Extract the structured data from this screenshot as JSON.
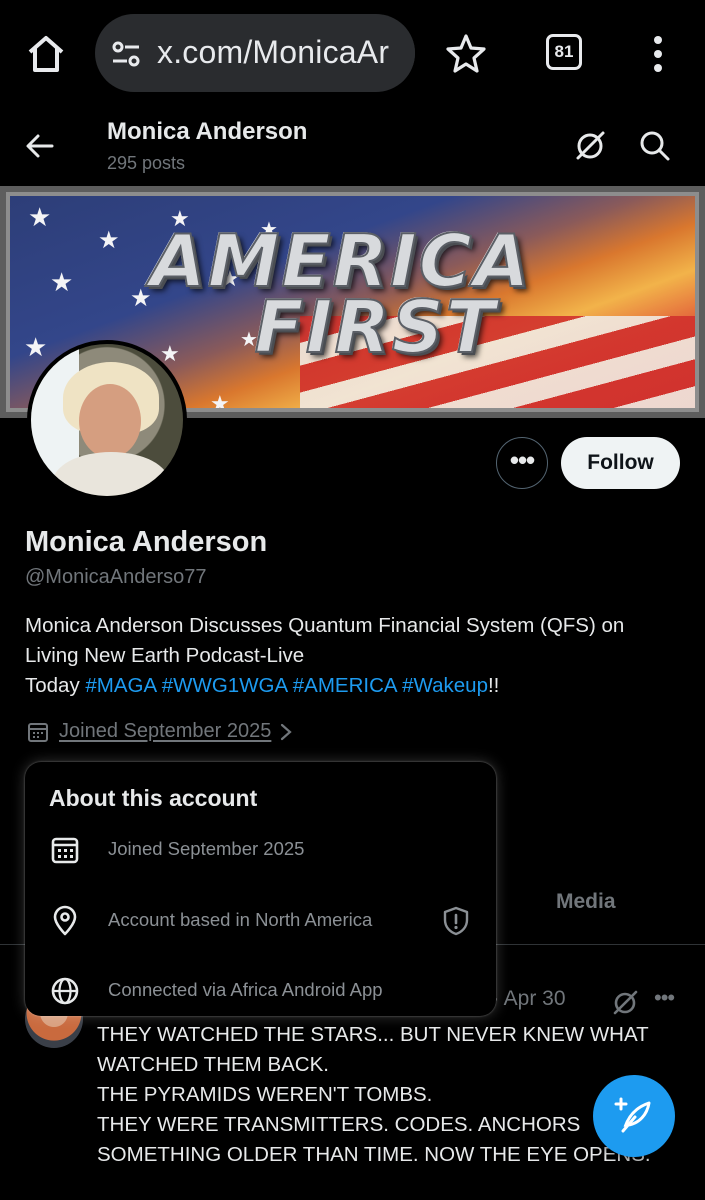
{
  "browser": {
    "url": "x.com/MonicaAr",
    "tab_count": "81"
  },
  "header": {
    "name": "Monica Anderson",
    "posts": "295 posts"
  },
  "banner": {
    "line1": "AMERICA",
    "line2": "FIRST"
  },
  "profile": {
    "follow_label": "Follow",
    "more_label": "•••",
    "name": "Monica Anderson",
    "handle": "@MonicaAnderso77",
    "bio_line1": "Monica Anderson Discusses Quantum Financial System (QFS) on",
    "bio_line2": "Living New Earth Podcast-Live",
    "bio_line3_prefix": "Today ",
    "hashtags": [
      "#MAGA",
      "#WWG1WGA",
      "#AMERICA",
      "#Wakeup"
    ],
    "bio_line3_suffix": "!!",
    "joined": "Joined September 2025"
  },
  "about_popup": {
    "title": "About this account",
    "rows": [
      {
        "icon": "calendar-icon",
        "text": "Joined September 2025"
      },
      {
        "icon": "location-pin-icon",
        "text": "Account based in North America"
      },
      {
        "icon": "globe-icon",
        "text": "Connected via Africa Android App"
      }
    ]
  },
  "tabs": {
    "media": "Media"
  },
  "post": {
    "date": "· Apr 30",
    "more": "•••",
    "lines": [
      "THEY WATCHED THE STARS... BUT NEVER KNEW WHAT",
      "WATCHED THEM BACK.",
      "THE PYRAMIDS WEREN'T TOMBS.",
      "THEY WERE TRANSMITTERS. CODES. ANCHORS",
      "SOMETHING OLDER THAN TIME. NOW THE EYE OPENS."
    ]
  },
  "colors": {
    "background": "#000000",
    "text_primary": "#e7e9ea",
    "text_secondary": "#71767b",
    "accent": "#1d9bf0",
    "follow_bg": "#eff3f4"
  }
}
